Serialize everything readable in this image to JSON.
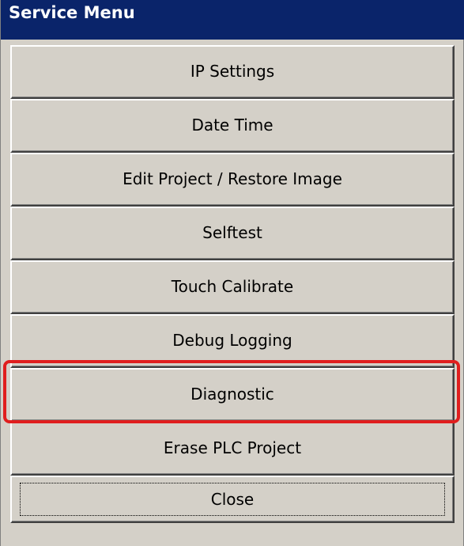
{
  "window": {
    "title": "Service Menu"
  },
  "menu": {
    "items": [
      {
        "label": "IP Settings"
      },
      {
        "label": "Date Time"
      },
      {
        "label": "Edit Project / Restore Image"
      },
      {
        "label": "Selftest"
      },
      {
        "label": "Touch Calibrate"
      },
      {
        "label": "Debug Logging"
      },
      {
        "label": "Diagnostic",
        "highlighted": true
      },
      {
        "label": "Erase PLC Project"
      }
    ],
    "close_label": "Close"
  },
  "colors": {
    "titlebar": "#0a246a",
    "button_face": "#d4d0c8",
    "highlight_outline": "#e01e1e"
  }
}
